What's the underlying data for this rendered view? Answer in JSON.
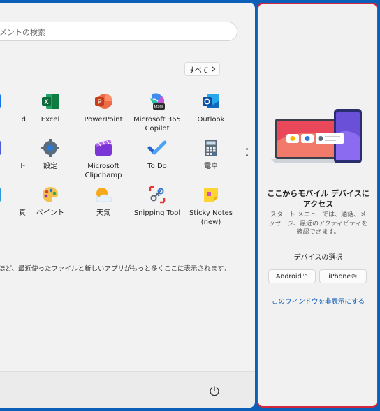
{
  "search": {
    "placeholder": "メントの検索"
  },
  "all_apps": {
    "label": "すべて",
    "icon": "chevron-right-icon"
  },
  "apps": [
    {
      "label": "d",
      "icon": "partial-blue-app-icon"
    },
    {
      "label": "Excel",
      "icon": "excel-icon"
    },
    {
      "label": "PowerPoint",
      "icon": "powerpoint-icon"
    },
    {
      "label": "Microsoft 365 Copilot",
      "icon": "m365-copilot-icon",
      "badge": "M365"
    },
    {
      "label": "Outlook",
      "icon": "outlook-icon"
    },
    {
      "label": "ト",
      "icon": "partial-store-app-icon"
    },
    {
      "label": "設定",
      "icon": "settings-gear-icon"
    },
    {
      "label": "Microsoft Clipchamp",
      "icon": "clipchamp-icon"
    },
    {
      "label": "To Do",
      "icon": "todo-check-icon"
    },
    {
      "label": "電卓",
      "icon": "calculator-icon"
    },
    {
      "label": "真",
      "icon": "partial-photos-app-icon"
    },
    {
      "label": "ペイント",
      "icon": "paint-palette-icon"
    },
    {
      "label": "天気",
      "icon": "weather-icon"
    },
    {
      "label": "Snipping Tool",
      "icon": "snipping-tool-icon"
    },
    {
      "label": "Sticky Notes (new)",
      "icon": "sticky-notes-icon"
    }
  ],
  "recommended": {
    "text": "ほど、最近使ったファイルと新しいアプリがもっと多くここに表示されます。"
  },
  "power": {
    "icon": "power-icon"
  },
  "phone_link": {
    "title": "ここからモバイル デバイスにアクセス",
    "description": "スタート メニューでは、通話、メッセージ、最近のアクティビティを確認できます。",
    "device_label": "デバイスの選択",
    "android_label": "Android™",
    "iphone_label": "iPhone®",
    "hide_label": "このウィンドウを非表示にする"
  },
  "colors": {
    "desktop_blue": "#0b5fb8",
    "panel_bg": "#f2f2f2",
    "focus_border": "#d1283b",
    "link_blue": "#0a5bb5"
  }
}
